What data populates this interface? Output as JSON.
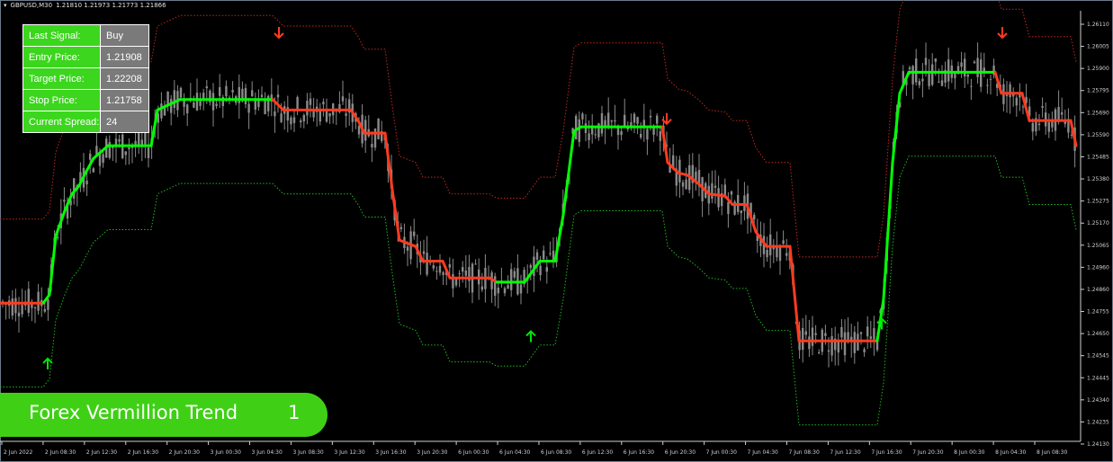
{
  "header": {
    "symbol": "GBPUSD,M30",
    "ohlc": "1.21810 1.21973 1.21773 1.21866"
  },
  "signal_panel": {
    "rows": [
      {
        "label": "Last Signal:",
        "value": "Buy"
      },
      {
        "label": "Entry Price:",
        "value": "1.21908"
      },
      {
        "label": "Target Price:",
        "value": "1.22208"
      },
      {
        "label": "Stop Price:",
        "value": "1.21758"
      },
      {
        "label": "Current Spread:",
        "value": "24"
      }
    ]
  },
  "brand": {
    "title": "Forex Vermillion Trend",
    "number": "1"
  },
  "colors": {
    "background": "#000000",
    "candle": "#8a8a8a",
    "up_trend": "#00ff00",
    "down_trend": "#ff3b1f",
    "band_upper": "#c0281e",
    "band_lower": "#1fb81f",
    "arrow_buy": "#00e600",
    "arrow_sell": "#ff3b1f",
    "panel_label": "#3bd61d",
    "panel_value": "#7a7a7a",
    "brand_bg": "#3fd016"
  },
  "chart_data": {
    "type": "line",
    "title": "",
    "xlabel": "",
    "ylabel": "",
    "ylim": [
      1.2413,
      1.2616
    ],
    "y_ticks": [
      "1.26110",
      "1.26005",
      "1.25900",
      "1.25795",
      "1.25690",
      "1.25590",
      "1.25485",
      "1.25380",
      "1.25275",
      "1.25170",
      "1.25065",
      "1.24960",
      "1.24860",
      "1.24755",
      "1.24650",
      "1.24545",
      "1.24445",
      "1.24340",
      "1.24235",
      "1.24130"
    ],
    "x_ticks": [
      "2 Jun 2022",
      "2 Jun 08:30",
      "2 Jun 12:30",
      "2 Jun 16:30",
      "2 Jun 20:30",
      "3 Jun 00:30",
      "3 Jun 04:30",
      "3 Jun 08:30",
      "3 Jun 12:30",
      "3 Jun 16:30",
      "3 Jun 20:30",
      "6 Jun 00:30",
      "6 Jun 04:30",
      "6 Jun 08:30",
      "6 Jun 12:30",
      "6 Jun 16:30",
      "6 Jun 20:30",
      "7 Jun 00:30",
      "7 Jun 04:30",
      "7 Jun 08:30",
      "7 Jun 12:30",
      "7 Jun 16:30",
      "7 Jun 20:30",
      "8 Jun 00:30",
      "8 Jun 04:30",
      "8 Jun 08:30"
    ],
    "grid": false,
    "trend_line": {
      "name": "",
      "points": [
        [
          0,
          1.2478,
          "down"
        ],
        [
          48,
          1.2478,
          "down"
        ],
        [
          55,
          1.2482,
          "up"
        ],
        [
          62,
          1.251,
          "up"
        ],
        [
          72,
          1.2522,
          "up"
        ],
        [
          80,
          1.253,
          "up"
        ],
        [
          88,
          1.2534,
          "up"
        ],
        [
          95,
          1.254,
          "up"
        ],
        [
          104,
          1.2547,
          "up"
        ],
        [
          112,
          1.255,
          "up"
        ],
        [
          120,
          1.2553,
          "up"
        ],
        [
          168,
          1.2553,
          "up"
        ],
        [
          175,
          1.257,
          "up"
        ],
        [
          190,
          1.2573,
          "up"
        ],
        [
          200,
          1.2575,
          "up"
        ],
        [
          303,
          1.2575,
          "up"
        ],
        [
          315,
          1.257,
          "down"
        ],
        [
          390,
          1.257,
          "down"
        ],
        [
          398,
          1.2565,
          "down"
        ],
        [
          405,
          1.2559,
          "down"
        ],
        [
          428,
          1.2559,
          "down"
        ],
        [
          436,
          1.2532,
          "down"
        ],
        [
          444,
          1.2508,
          "down"
        ],
        [
          462,
          1.2505,
          "down"
        ],
        [
          470,
          1.2498,
          "down"
        ],
        [
          492,
          1.2498,
          "down"
        ],
        [
          500,
          1.249,
          "down"
        ],
        [
          544,
          1.249,
          "down"
        ],
        [
          552,
          1.2488,
          "down"
        ],
        [
          583,
          1.2488,
          "up"
        ],
        [
          600,
          1.2498,
          "up"
        ],
        [
          617,
          1.2498,
          "up"
        ],
        [
          626,
          1.252,
          "up"
        ],
        [
          638,
          1.256,
          "up"
        ],
        [
          646,
          1.2562,
          "up"
        ],
        [
          736,
          1.2562,
          "up"
        ],
        [
          742,
          1.2545,
          "down"
        ],
        [
          754,
          1.254,
          "down"
        ],
        [
          764,
          1.2539,
          "down"
        ],
        [
          776,
          1.2535,
          "down"
        ],
        [
          788,
          1.253,
          "down"
        ],
        [
          806,
          1.2529,
          "down"
        ],
        [
          814,
          1.2525,
          "down"
        ],
        [
          830,
          1.2525,
          "down"
        ],
        [
          840,
          1.2512,
          "down"
        ],
        [
          852,
          1.2505,
          "down"
        ],
        [
          878,
          1.2505,
          "down"
        ],
        [
          888,
          1.246,
          "down"
        ],
        [
          975,
          1.246,
          "down"
        ],
        [
          982,
          1.248,
          "up"
        ],
        [
          992,
          1.2545,
          "up"
        ],
        [
          1000,
          1.2578,
          "up"
        ],
        [
          1010,
          1.2588,
          "up"
        ],
        [
          1106,
          1.2588,
          "up"
        ],
        [
          1113,
          1.2578,
          "down"
        ],
        [
          1136,
          1.2578,
          "down"
        ],
        [
          1144,
          1.2565,
          "down"
        ],
        [
          1190,
          1.2565,
          "down"
        ],
        [
          1196,
          1.2553,
          "down"
        ]
      ]
    },
    "signals": [
      {
        "type": "buy",
        "price": 1.2449
      },
      {
        "type": "sell",
        "price": 1.2607
      },
      {
        "type": "buy",
        "price": 1.2462
      },
      {
        "type": "sell",
        "price": 1.2566
      },
      {
        "type": "buy",
        "price": 1.2468
      },
      {
        "type": "sell",
        "price": 1.2607
      }
    ]
  }
}
